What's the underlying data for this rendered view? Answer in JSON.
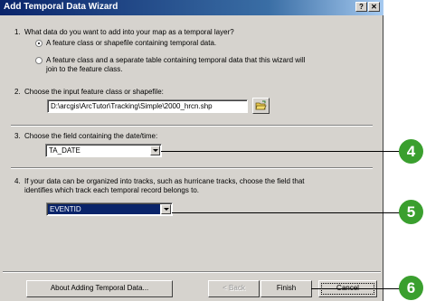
{
  "window": {
    "title": "Add Temporal Data Wizard",
    "help_label": "?",
    "close_label": "✕"
  },
  "steps": [
    {
      "number": "1.",
      "text": "What data do you want to add into your map as a temporal layer?"
    },
    {
      "number": "2.",
      "text": "Choose the input feature class or shapefile:"
    },
    {
      "number": "3.",
      "text": "Choose the field containing the date/time:"
    },
    {
      "number": "4.",
      "text_line1": "If your data can be organized into tracks, such as hurricane tracks, choose the field that",
      "text_line2": "identifies which track each temporal record belongs to."
    }
  ],
  "options": [
    {
      "label": "A feature class or shapefile containing temporal data.",
      "selected": true
    },
    {
      "label_line1": "A feature class and a separate table containing temporal data that this wizard will",
      "label_line2": "join to the feature class.",
      "selected": false
    }
  ],
  "input_path": {
    "value": "D:\\arcgis\\ArcTutor\\Tracking\\Simple\\2000_hrcn.shp"
  },
  "date_field": {
    "value": "TA_DATE"
  },
  "track_field": {
    "value": "EVENTID"
  },
  "buttons": {
    "about": "About Adding Temporal Data...",
    "back": "< Back",
    "finish": "Finish",
    "cancel": "Cancel"
  },
  "callouts": [
    "4",
    "5",
    "6"
  ],
  "colors": {
    "callout": "#3a9f2e",
    "titlebar": "#0a246a",
    "selection": "#0a246a"
  }
}
